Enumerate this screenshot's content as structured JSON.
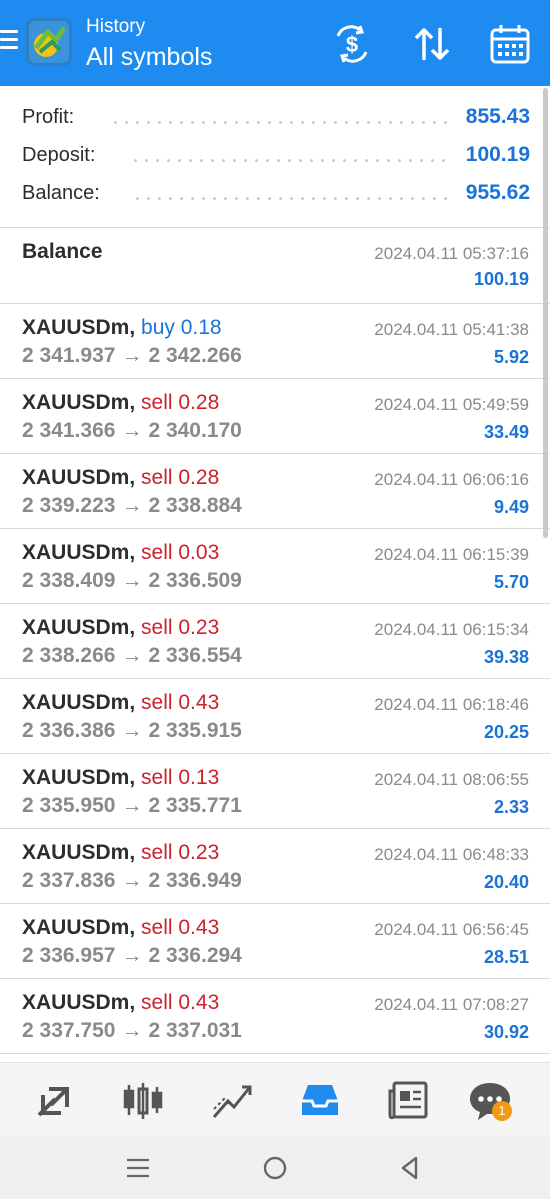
{
  "header": {
    "subtitle": "History",
    "title": "All symbols",
    "icons": [
      "menu-icon",
      "app-logo",
      "dollar-refresh-icon",
      "sort-arrows-icon",
      "calendar-icon"
    ]
  },
  "summary": {
    "profit_label": "Profit:",
    "profit_value": "855.43",
    "deposit_label": "Deposit:",
    "deposit_value": "100.19",
    "balance_label": "Balance:",
    "balance_value": "955.62"
  },
  "balance_entry": {
    "label": "Balance",
    "time": "2024.04.11 05:37:16",
    "amount": "100.19"
  },
  "deals": [
    {
      "symbol": "XAUUSDm,",
      "side": "buy 0.18",
      "side_type": "buy",
      "open": "2 341.937",
      "close": "2 342.266",
      "time": "2024.04.11 05:41:38",
      "profit": "5.92"
    },
    {
      "symbol": "XAUUSDm,",
      "side": "sell 0.28",
      "side_type": "sell",
      "open": "2 341.366",
      "close": "2 340.170",
      "time": "2024.04.11 05:49:59",
      "profit": "33.49"
    },
    {
      "symbol": "XAUUSDm,",
      "side": "sell 0.28",
      "side_type": "sell",
      "open": "2 339.223",
      "close": "2 338.884",
      "time": "2024.04.11 06:06:16",
      "profit": "9.49"
    },
    {
      "symbol": "XAUUSDm,",
      "side": "sell 0.03",
      "side_type": "sell",
      "open": "2 338.409",
      "close": "2 336.509",
      "time": "2024.04.11 06:15:39",
      "profit": "5.70"
    },
    {
      "symbol": "XAUUSDm,",
      "side": "sell 0.23",
      "side_type": "sell",
      "open": "2 338.266",
      "close": "2 336.554",
      "time": "2024.04.11 06:15:34",
      "profit": "39.38"
    },
    {
      "symbol": "XAUUSDm,",
      "side": "sell 0.43",
      "side_type": "sell",
      "open": "2 336.386",
      "close": "2 335.915",
      "time": "2024.04.11 06:18:46",
      "profit": "20.25"
    },
    {
      "symbol": "XAUUSDm,",
      "side": "sell 0.13",
      "side_type": "sell",
      "open": "2 335.950",
      "close": "2 335.771",
      "time": "2024.04.11 08:06:55",
      "profit": "2.33"
    },
    {
      "symbol": "XAUUSDm,",
      "side": "sell 0.23",
      "side_type": "sell",
      "open": "2 337.836",
      "close": "2 336.949",
      "time": "2024.04.11 06:48:33",
      "profit": "20.40"
    },
    {
      "symbol": "XAUUSDm,",
      "side": "sell 0.43",
      "side_type": "sell",
      "open": "2 336.957",
      "close": "2 336.294",
      "time": "2024.04.11 06:56:45",
      "profit": "28.51"
    },
    {
      "symbol": "XAUUSDm,",
      "side": "sell 0.43",
      "side_type": "sell",
      "open": "2 337.750",
      "close": "2 337.031",
      "time": "2024.04.11 07:08:27",
      "profit": "30.92"
    }
  ],
  "deal_arrow": "→",
  "bottom_nav": {
    "items": [
      "quotes-icon",
      "chart-icon",
      "trade-icon",
      "history-icon",
      "news-icon",
      "chat-icon"
    ],
    "active": "history-icon",
    "chat_badge": "1"
  },
  "system_nav": [
    "recent-apps-icon",
    "home-icon",
    "back-icon"
  ],
  "colors": {
    "appbar": "#1d8bf0",
    "profit_blue": "#1a73d9",
    "sell_red": "#c9232b",
    "muted": "#8a8a8a"
  }
}
